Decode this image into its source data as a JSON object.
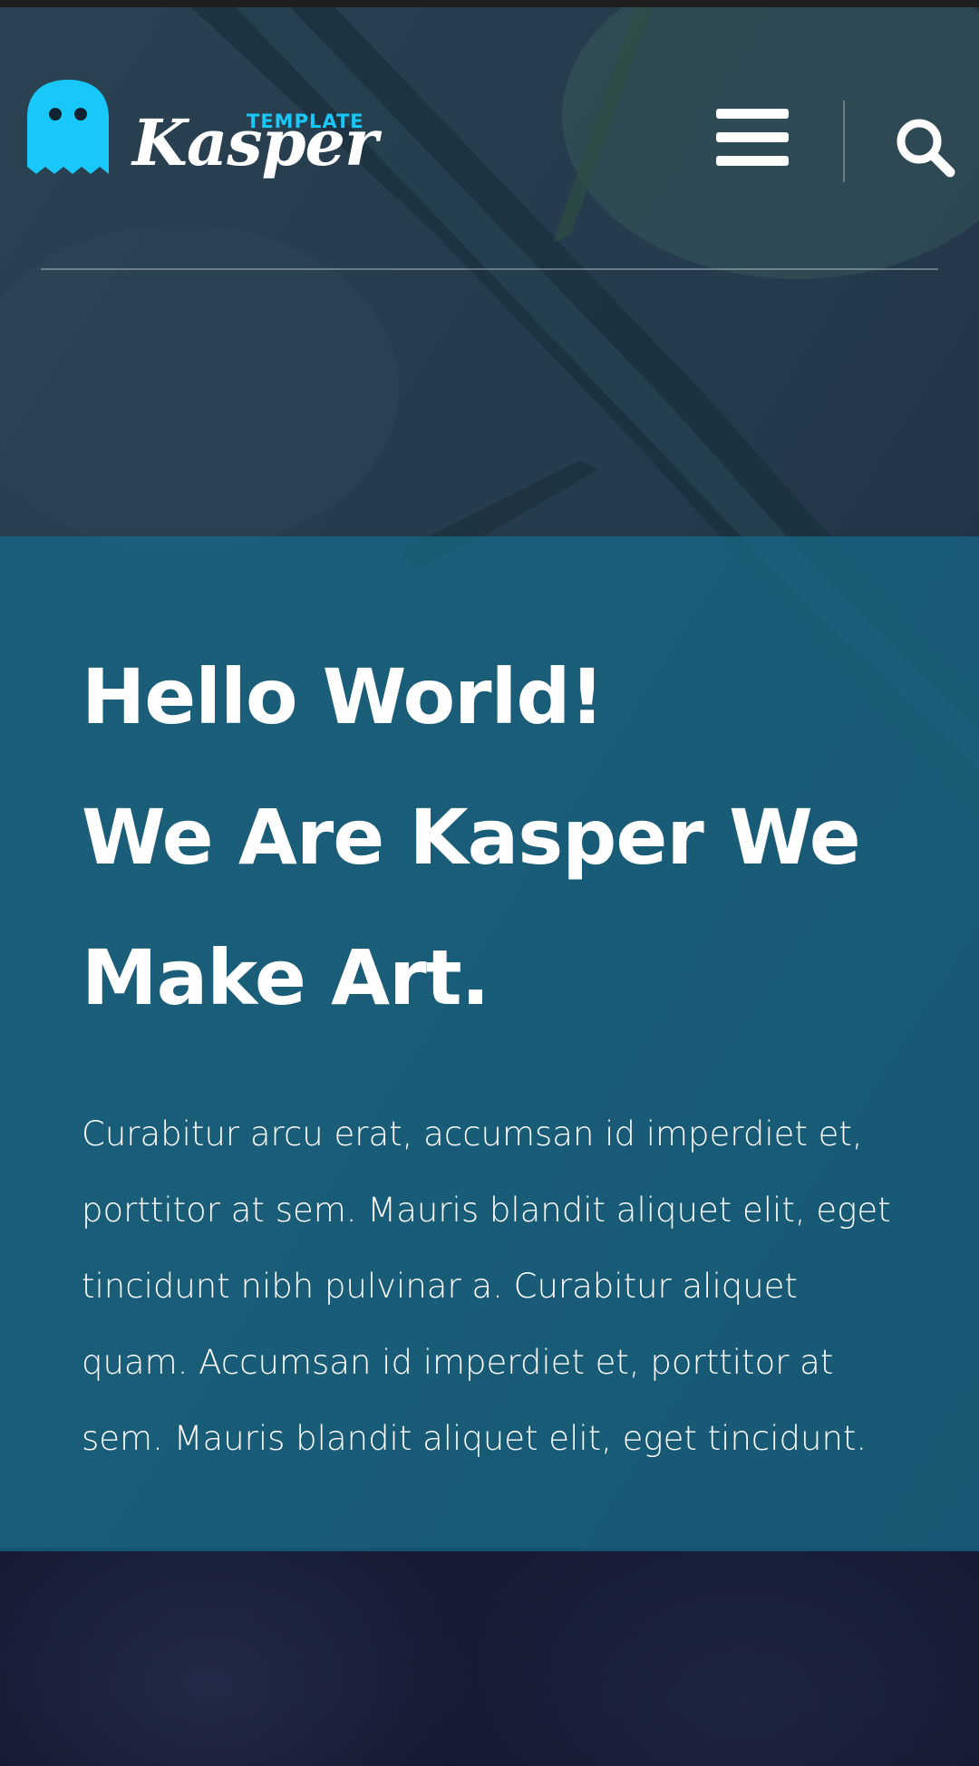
{
  "header": {
    "logo": {
      "tagline": "TEMPLATE",
      "name": "Kasper",
      "icon": "ghost-icon",
      "colors": {
        "icon": "#19c8fa",
        "tagline": "#19c8fa",
        "name": "#ffffff"
      }
    },
    "menu_icon": "menu-icon",
    "search_icon": "search-icon"
  },
  "intro": {
    "title_lines": [
      "Hello World!",
      "We Are Kasper We",
      "Make Art."
    ],
    "text_lines": [
      "Curabitur arcu erat, accumsan id imperdiet et,",
      "porttitor at sem. Mauris blandit aliquet elit, eget",
      "tincidunt nibh pulvinar a. Curabitur aliquet",
      "quam. Accumsan id imperdiet et, porttitor at",
      "sem. Mauris blandit aliquet elit, eget tincidunt."
    ],
    "overlay_color": "#156c8c"
  }
}
